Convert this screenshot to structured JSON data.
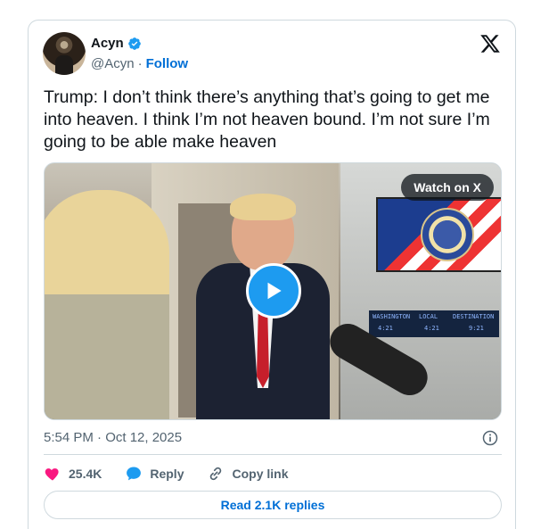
{
  "author": {
    "name": "Acyn",
    "handle": "@Acyn",
    "separator": "·",
    "follow_label": "Follow"
  },
  "tweet": {
    "text": "Trump: I don’t think there’s anything that’s going to get me into heaven. I think I’m not heaven bound. I’m not sure I’m going to be able make heaven",
    "timestamp": "5:54 PM · Oct 12, 2025"
  },
  "media": {
    "watch_label": "Watch on X",
    "readout_labels": [
      "WASHINGTON",
      "LOCAL",
      "DESTINATION"
    ],
    "readout_values": [
      "4:21",
      "4:21",
      "9:21"
    ]
  },
  "actions": {
    "likes": "25.4K",
    "reply_label": "Reply",
    "copy_link_label": "Copy link"
  },
  "replies_button": "Read 2.1K replies",
  "colors": {
    "accent": "#1d9bf0",
    "link": "#006fd6",
    "like": "#f91880",
    "text_secondary": "#536471",
    "border": "#cfd9de"
  },
  "icons": [
    "verified-badge-icon",
    "x-logo-icon",
    "play-icon",
    "info-icon",
    "heart-icon",
    "reply-icon",
    "link-icon"
  ]
}
